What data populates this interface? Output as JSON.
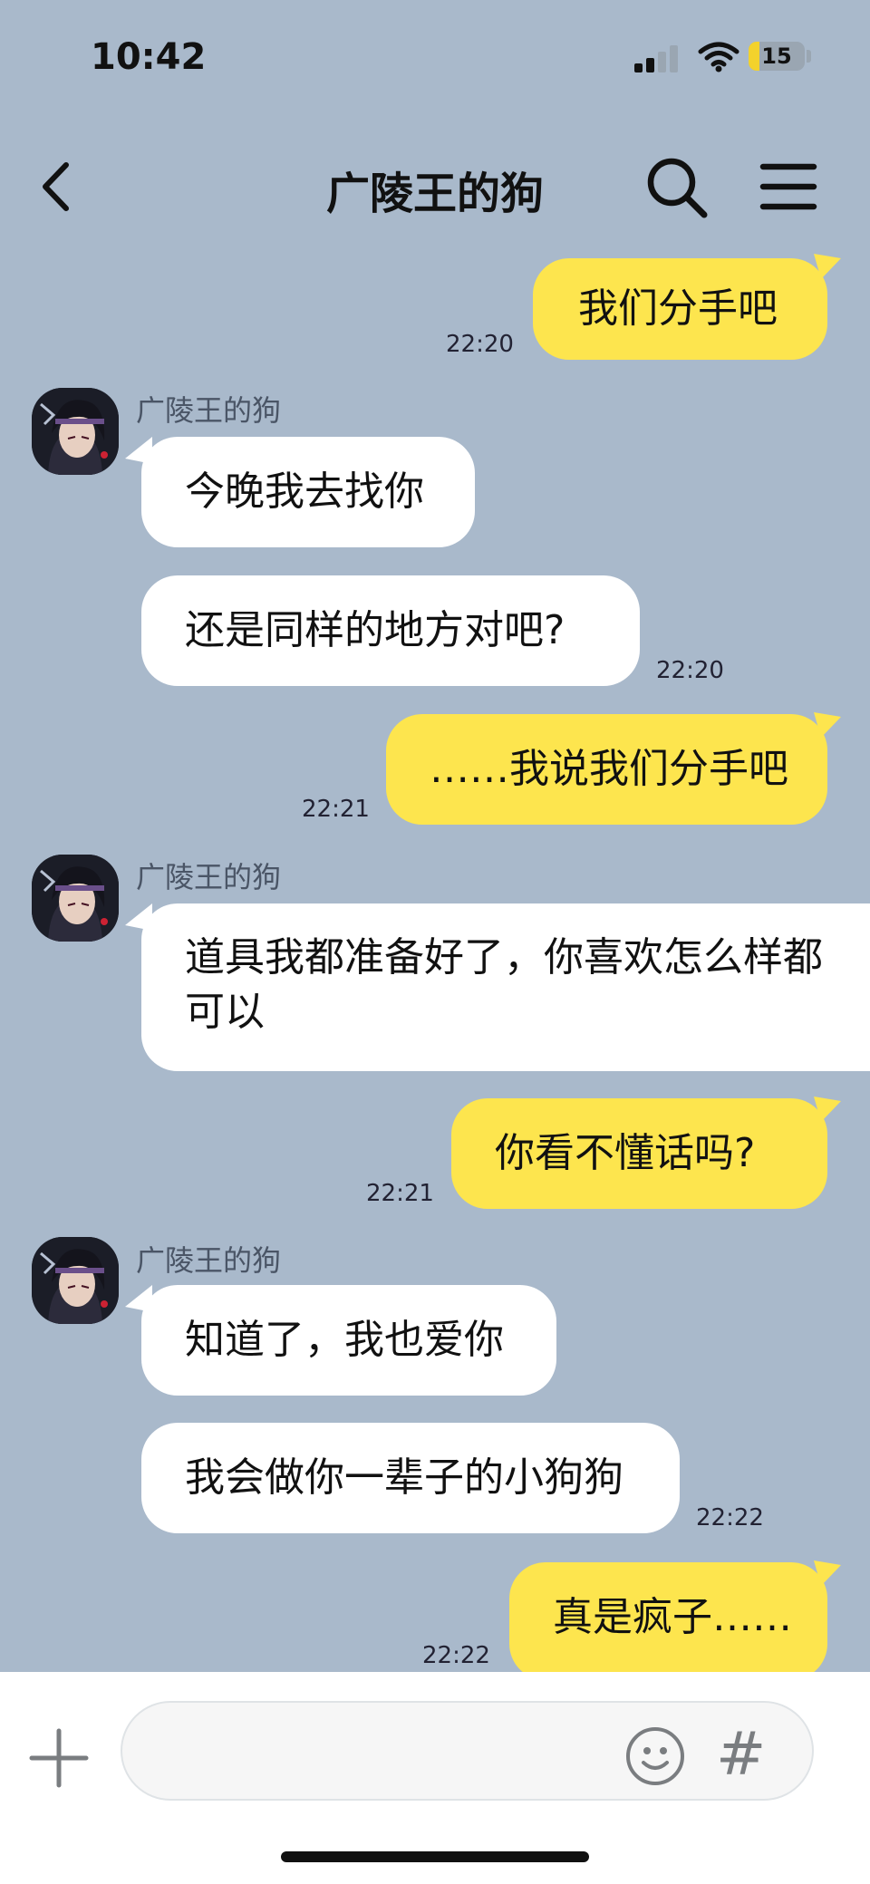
{
  "status_bar": {
    "time": "10:42",
    "battery": "15"
  },
  "header": {
    "title": "广陵王的狗"
  },
  "contact": {
    "name": "广陵王的狗"
  },
  "messages": [
    {
      "from": "me",
      "text": "我们分手吧",
      "time": "22:20"
    },
    {
      "from": "other",
      "text": "今晚我去找你"
    },
    {
      "from": "other",
      "text": "还是同样的地方对吧?",
      "time": "22:20"
    },
    {
      "from": "me",
      "text": "……我说我们分手吧",
      "time": "22:21"
    },
    {
      "from": "other",
      "text": "道具我都准备好了，你喜欢怎么样都可以"
    },
    {
      "from": "me",
      "text": "你看不懂话吗?",
      "time": "22:21"
    },
    {
      "from": "other",
      "text": "知道了，我也爱你"
    },
    {
      "from": "other",
      "text": "我会做你一辈子的小狗狗",
      "time": "22:22"
    },
    {
      "from": "me",
      "text": "真是疯子……",
      "time": "22:22"
    }
  ],
  "input": {
    "hash_label": "#"
  }
}
